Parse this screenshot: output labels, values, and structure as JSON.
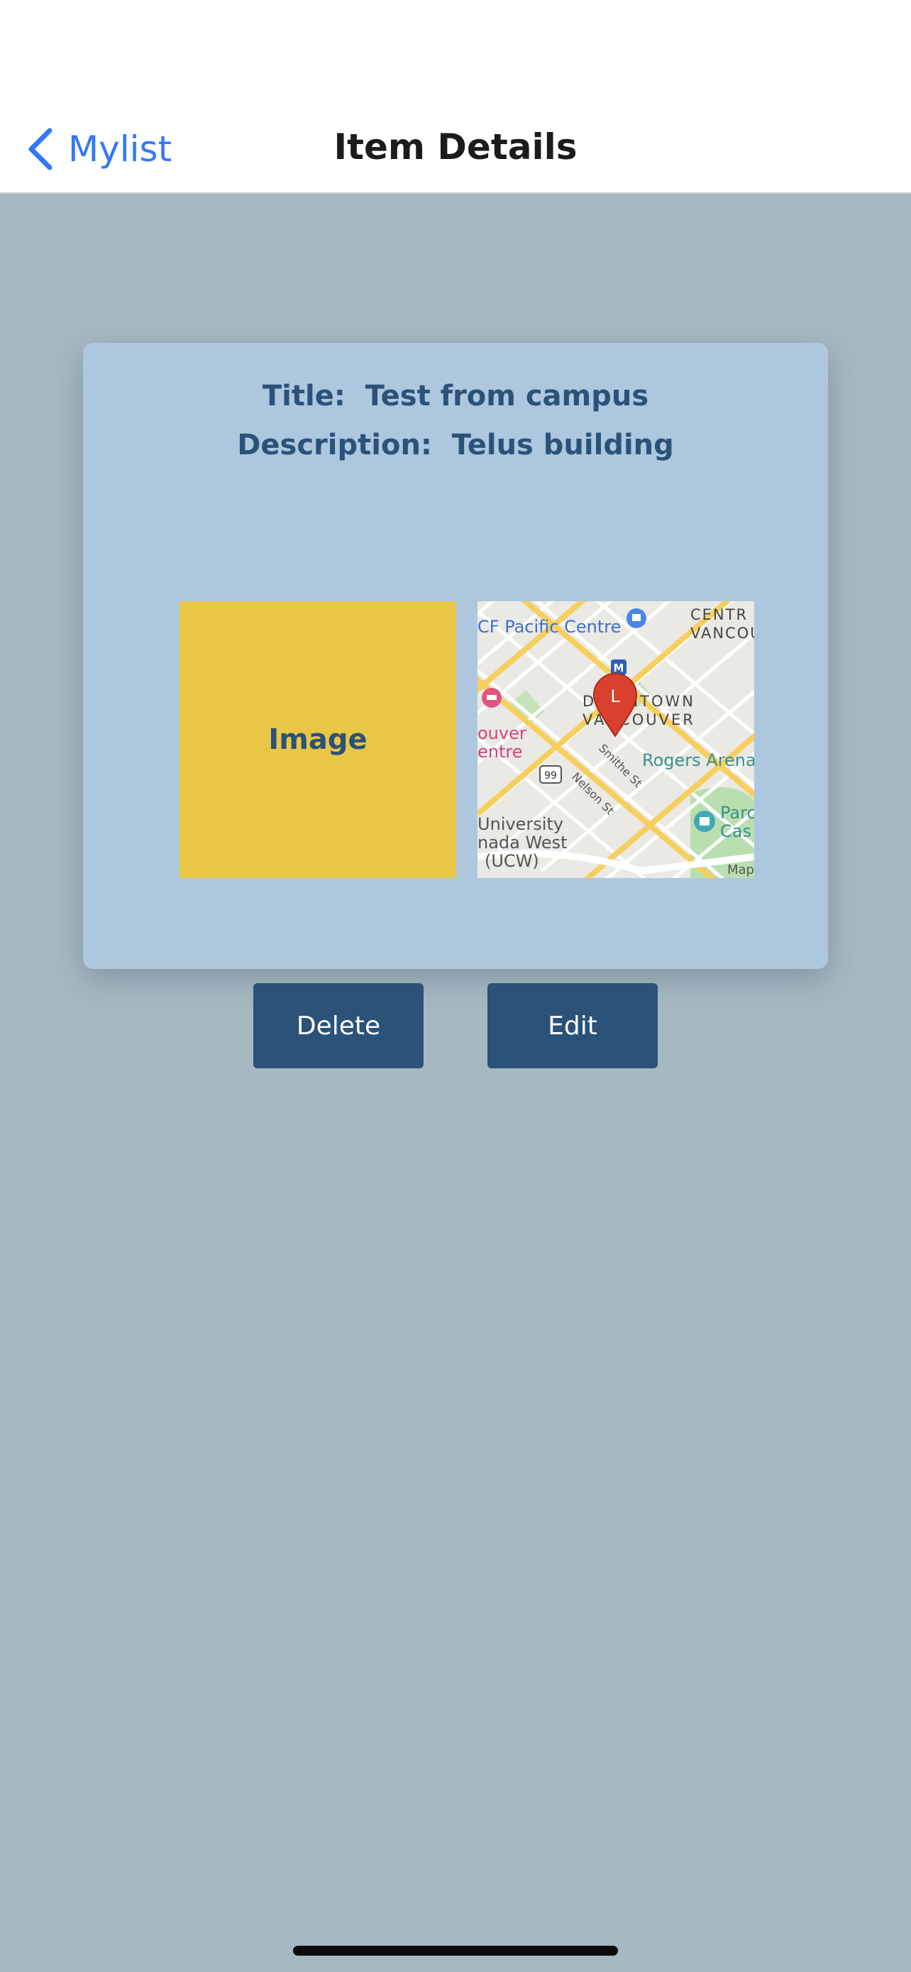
{
  "nav": {
    "back_label": "Mylist",
    "title": "Item Details"
  },
  "item": {
    "title_line": "Title:  Test from campus",
    "description_line": "Description:  Telus building",
    "image_placeholder": "Image"
  },
  "map": {
    "labels": {
      "pacific_centre": "CF Pacific Centre",
      "central_1": "CENTR",
      "central_2": "VANCOU",
      "downtown_1": "DOWNTOWN",
      "downtown_2": "VANCOUVER",
      "rogers": "Rogers Arena",
      "smithe": "Smithe St",
      "nelson": "Nelson St",
      "route": "99",
      "vancouver_1": "ouver",
      "vancouver_2": "entre",
      "university_1": "University",
      "university_2": "nada West",
      "university_3": "(UCW)",
      "park_1": "Parc",
      "park_2": "Cas",
      "attribution": "Map",
      "pin_letter": "L",
      "metro": "M"
    },
    "colors": {
      "pin": "#d9402e",
      "road_major": "#f6cf5f",
      "park": "#b9dfb0",
      "poi_shopping": "#4a86e8",
      "poi_hotel": "#e2557f",
      "poi_park": "#3fa9b5"
    }
  },
  "actions": {
    "delete_label": "Delete",
    "edit_label": "Edit"
  },
  "colors": {
    "background": "#a6b8c2",
    "card": "#adc7df",
    "accent_text": "#2b5278",
    "button": "#2b5278",
    "image_fill": "#e8c746",
    "ios_blue": "#3478f6"
  }
}
